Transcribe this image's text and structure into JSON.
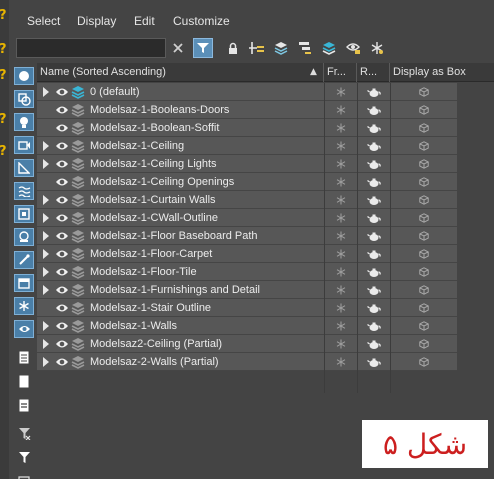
{
  "menu": [
    "Select",
    "Display",
    "Edit",
    "Customize"
  ],
  "search": {
    "value": "",
    "placeholder": ""
  },
  "toolbar_icons": [
    "clear-search-icon",
    "filter-icon",
    "lock-icon",
    "add-to-layer-icon",
    "layers-icon",
    "hierarchy-icon",
    "layer-stack-icon",
    "highlight-icon",
    "freeze-icon"
  ],
  "table": {
    "columns": {
      "name": "Name (Sorted Ascending)",
      "frozen": "Fr...",
      "renderable": "R...",
      "display_as_box": "Display as Box"
    },
    "rows": [
      {
        "name": "0 (default)",
        "expandable": true,
        "active_layer": true
      },
      {
        "name": "Modelsaz-1-Booleans-Doors",
        "expandable": false,
        "active_layer": false
      },
      {
        "name": "Modelsaz-1-Boolean-Soffit",
        "expandable": false,
        "active_layer": false
      },
      {
        "name": " Modelsaz-1-Ceiling",
        "expandable": true,
        "active_layer": false
      },
      {
        "name": "Modelsaz-1-Ceiling Lights",
        "expandable": true,
        "active_layer": false
      },
      {
        "name": "Modelsaz-1-Ceiling Openings",
        "expandable": false,
        "active_layer": false
      },
      {
        "name": "Modelsaz-1-Curtain Walls",
        "expandable": true,
        "active_layer": false
      },
      {
        "name": "Modelsaz-1-CWall-Outline",
        "expandable": true,
        "active_layer": false
      },
      {
        "name": "Modelsaz-1-Floor Baseboard Path",
        "expandable": true,
        "active_layer": false
      },
      {
        "name": "Modelsaz-1-Floor-Carpet",
        "expandable": true,
        "active_layer": false
      },
      {
        "name": "Modelsaz-1-Floor-Tile",
        "expandable": true,
        "active_layer": false
      },
      {
        "name": "Modelsaz-1-Furnishings and Detail",
        "expandable": true,
        "active_layer": false
      },
      {
        "name": "Modelsaz-1-Stair Outline",
        "expandable": false,
        "active_layer": false
      },
      {
        "name": "Modelsaz-1-Walls",
        "expandable": true,
        "active_layer": false
      },
      {
        "name": "Modelsaz2-Ceiling (Partial)",
        "expandable": true,
        "active_layer": false
      },
      {
        "name": "Modelsaz-2-Walls (Partial)",
        "expandable": true,
        "active_layer": false
      }
    ]
  },
  "caption": "شکل ۵",
  "colors": {
    "background": "#444444",
    "row": "#575757",
    "accent": "#5b8fb8",
    "active_layer": "#39b6d6",
    "caption_text": "#cc1f1f"
  }
}
